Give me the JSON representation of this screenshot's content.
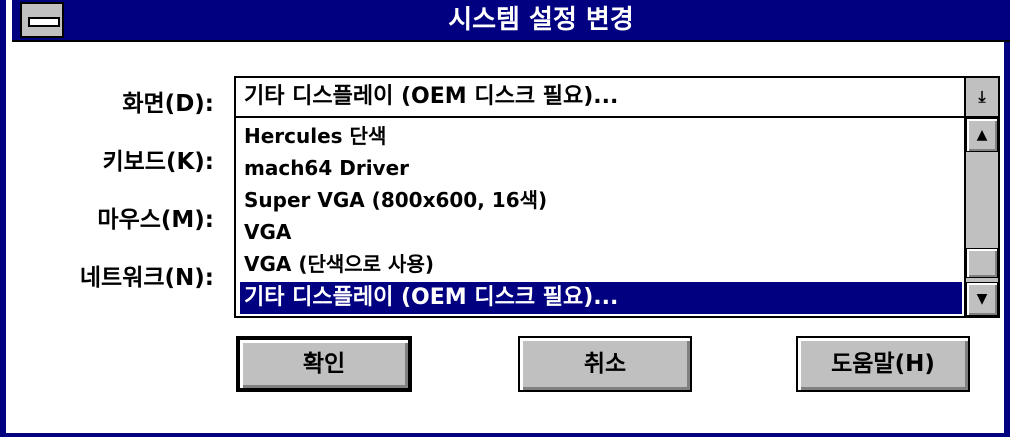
{
  "window": {
    "title": "시스템 설정 변경"
  },
  "labels": {
    "display": "화면(D):",
    "keyboard": "키보드(K):",
    "mouse": "마우스(M):",
    "network": "네트워크(N):"
  },
  "display_combo": {
    "value": "기타 디스플레이 (OEM 디스크 필요)...",
    "options": [
      "Hercules 단색",
      "mach64 Driver",
      "Super VGA (800x600, 16색)",
      "VGA",
      "VGA (단색으로 사용)",
      "기타 디스플레이 (OEM 디스크 필요)..."
    ],
    "selected_index": 5
  },
  "buttons": {
    "ok": "확인",
    "cancel": "취소",
    "help": "도움말(H)"
  },
  "icons": {
    "dropdown": "down-arrow-icon",
    "scroll_up": "up-arrow-icon",
    "scroll_down": "down-arrow-icon",
    "system_menu": "system-menu-icon"
  },
  "colors": {
    "title_bar": "#000080",
    "selection": "#000080",
    "button_face": "#c0c0c0"
  }
}
